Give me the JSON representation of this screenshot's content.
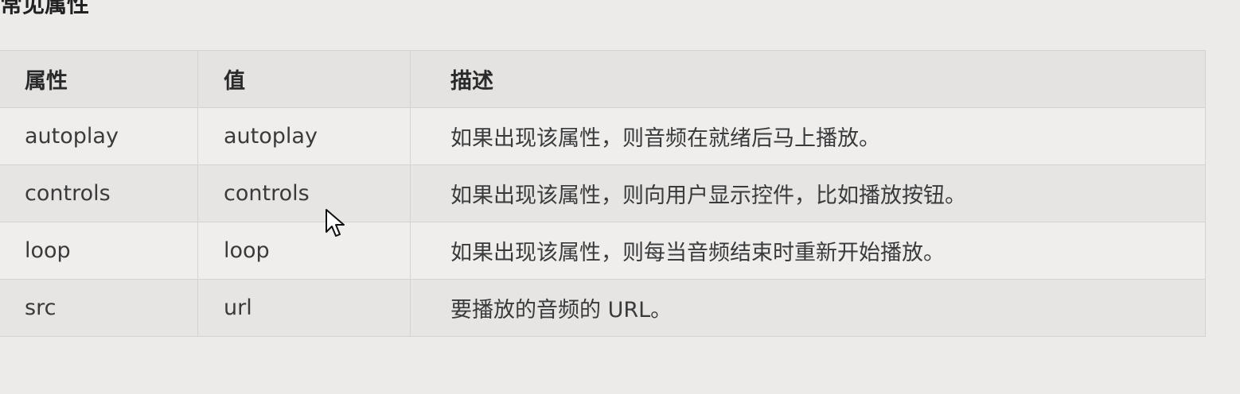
{
  "section": {
    "title": "常见属性"
  },
  "table": {
    "headers": [
      "属性",
      "值",
      "描述"
    ],
    "rows": [
      {
        "attribute": "autoplay",
        "value": "autoplay",
        "description": "如果出现该属性，则音频在就绪后马上播放。"
      },
      {
        "attribute": "controls",
        "value": "controls",
        "description": "如果出现该属性，则向用户显示控件，比如播放按钮。"
      },
      {
        "attribute": "loop",
        "value": "loop",
        "description": "如果出现该属性，则每当音频结束时重新开始播放。"
      },
      {
        "attribute": "src",
        "value": "url",
        "description": "要播放的音频的 URL。"
      }
    ]
  },
  "cursor": {
    "icon": "mouse-pointer-icon"
  }
}
